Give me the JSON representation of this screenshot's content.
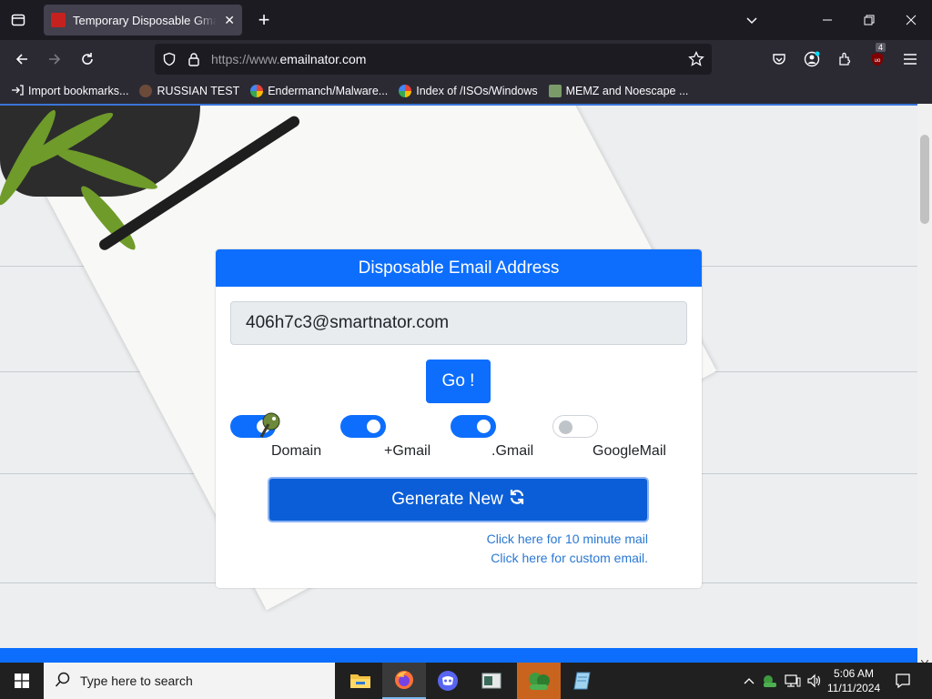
{
  "browser": {
    "tab_title": "Temporary Disposable Gmail | T",
    "url_protocol": "https://www.",
    "url_domain": "emailnator.com",
    "extension_badge": "4"
  },
  "bookmarks": [
    {
      "label": "Import bookmarks..."
    },
    {
      "label": "RUSSIAN TEST"
    },
    {
      "label": "Endermanch/Malware..."
    },
    {
      "label": "Index of /ISOs/Windows"
    },
    {
      "label": "MEMZ and Noescape ..."
    }
  ],
  "card": {
    "header": "Disposable Email Address",
    "email_value": "406h7c3@smartnator.com",
    "go_label": "Go !",
    "options": [
      {
        "label": "Domain",
        "checked": true
      },
      {
        "label": "+Gmail",
        "checked": true
      },
      {
        "label": ".Gmail",
        "checked": true
      },
      {
        "label": "GoogleMail",
        "checked": false
      }
    ],
    "generate_label": "Generate New",
    "link_10min": "Click here for 10 minute mail",
    "link_custom": "Click here for custom email."
  },
  "taskbar": {
    "search_placeholder": "Type here to search",
    "time": "5:06 AM",
    "date": "11/11/2024"
  },
  "colors": {
    "accent": "#0d6efd",
    "link": "#2a78d3"
  }
}
